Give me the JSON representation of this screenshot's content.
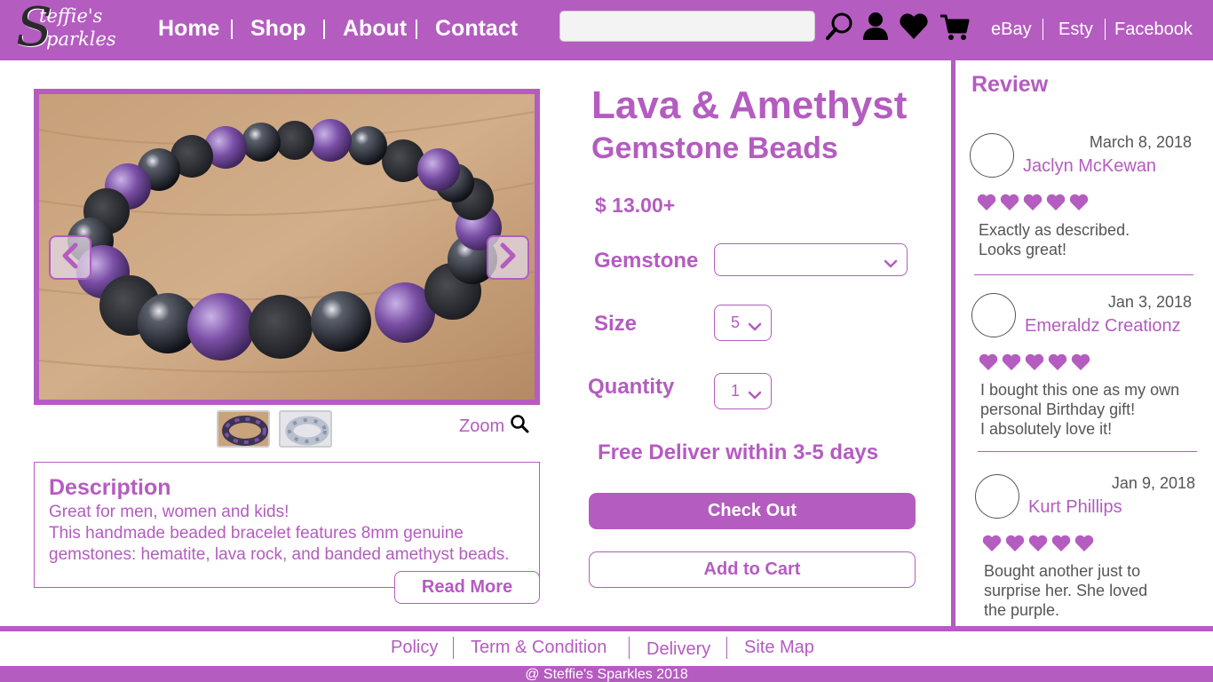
{
  "logo": {
    "line1": "teffie's",
    "line2": "parkles",
    "initial": "S"
  },
  "nav": {
    "home": "Home",
    "shop": "Shop",
    "about": "About",
    "contact": "Contact"
  },
  "search": {
    "placeholder": ""
  },
  "header_icons": [
    "search-icon",
    "user-icon",
    "heart-icon",
    "cart-icon"
  ],
  "marketplaces": {
    "ebay": "eBay",
    "etsy": "Esty",
    "facebook": "Facebook"
  },
  "product": {
    "title_line1": "Lava & Amethyst",
    "title_line2": "Gemstone Beads",
    "price": "$ 13.00+",
    "gemstone_label": "Gemstone",
    "gemstone_value": "",
    "size_label": "Size",
    "size_value": "5",
    "quantity_label": "Quantity",
    "quantity_value": "1",
    "delivery": "Free Deliver within 3-5 days",
    "checkout_label": "Check Out",
    "add_to_cart_label": "Add to Cart"
  },
  "gallery": {
    "zoom_label": "Zoom"
  },
  "description": {
    "heading": "Description",
    "line1": "Great for men, women and kids!",
    "line2": "This handmade beaded bracelet features 8mm genuine",
    "line3": "gemstones: hematite, lava rock, and banded amethyst beads.",
    "read_more": "Read More"
  },
  "reviews": {
    "title": "Review",
    "items": [
      {
        "date": "March 8, 2018",
        "name": "Jaclyn McKewan",
        "rating": 5,
        "text1": "Exactly as described.",
        "text2": "Looks great!",
        "text3": ""
      },
      {
        "date": "Jan 3, 2018",
        "name": "Emeraldz Creationz",
        "rating": 5,
        "text1": "I bought this one as my own",
        "text2": "personal Birthday gift!",
        "text3": "I absolutely love it!"
      },
      {
        "date": "Jan 9, 2018",
        "name": "Kurt Phillips",
        "rating": 5,
        "text1": "Bought another just to",
        "text2": "surprise her. She loved",
        "text3": "the purple."
      }
    ]
  },
  "footer": {
    "policy": "Policy",
    "terms": "Term & Condition",
    "delivery": "Delivery",
    "sitemap": "Site Map",
    "copyright": "@ Steffie's Sparkles 2018"
  },
  "colors": {
    "brand": "#b45cc0",
    "text_gray": "#555555"
  }
}
